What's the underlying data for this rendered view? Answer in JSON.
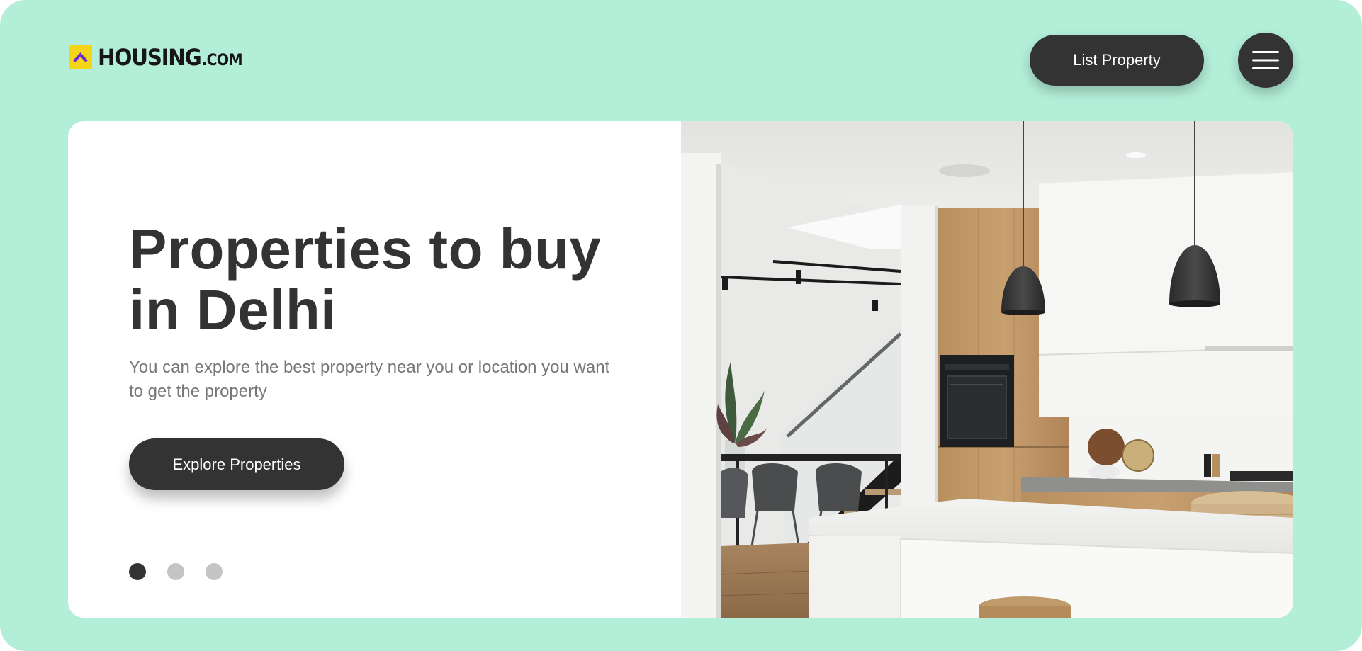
{
  "header": {
    "logo_text": "HOUSING",
    "logo_suffix": ".COM",
    "list_property_label": "List Property",
    "menu_icon": "hamburger-menu-icon"
  },
  "hero": {
    "title_line1": "Properties to buy",
    "title_line2": "in Delhi",
    "subtitle": "You can explore the best property near you or location you want to get the property",
    "cta_label": "Explore Properties",
    "image_icon": "kitchen-interior-photo"
  },
  "carousel": {
    "slide_count": 3,
    "active_index": 0
  },
  "colors": {
    "background": "#b2eed8",
    "dark": "#333333",
    "card": "#ffffff",
    "logo_yellow": "#f6d417",
    "logo_purple": "#6c2bd9"
  }
}
